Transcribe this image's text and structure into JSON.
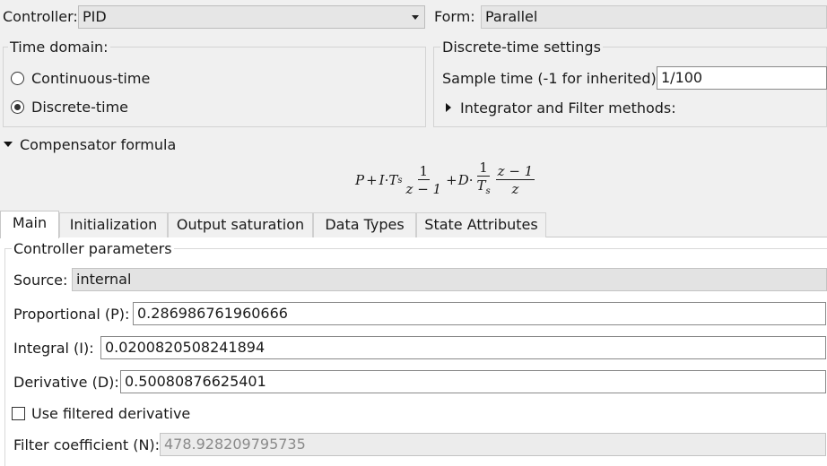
{
  "controller": {
    "label": "Controller:",
    "value": "PID"
  },
  "form": {
    "label": "Form:",
    "value": "Parallel"
  },
  "time_domain": {
    "title": "Time domain:",
    "options": [
      {
        "label": "Continuous-time",
        "selected": false
      },
      {
        "label": "Discrete-time",
        "selected": true
      }
    ]
  },
  "discrete_settings": {
    "title": "Discrete-time settings",
    "sample_time_label": "Sample time (-1 for inherited):",
    "sample_time_value": "1/100",
    "methods_label": "Integrator and Filter methods:"
  },
  "compensator": {
    "label": "Compensator formula",
    "formula": {
      "p": "P",
      "plus1": "+",
      "i": "I",
      "dot1": "·",
      "t": "T",
      "s": "s",
      "one": "1",
      "zm1": "z − 1",
      "plus2": "+",
      "d": "D",
      "dot2": "·",
      "one2": "1",
      "ts": "T",
      "s2": "s",
      "zm1b": "z − 1",
      "z": "z"
    }
  },
  "tabs": [
    {
      "label": "Main",
      "active": true
    },
    {
      "label": "Initialization",
      "active": false
    },
    {
      "label": "Output saturation",
      "active": false
    },
    {
      "label": "Data Types",
      "active": false
    },
    {
      "label": "State Attributes",
      "active": false
    }
  ],
  "params": {
    "title": "Controller parameters",
    "source_label": "Source:",
    "source_value": "internal",
    "p_label": "Proportional (P):",
    "p_value": "0.286986761960666",
    "i_label": "Integral (I):",
    "i_value": "0.0200820508241894",
    "d_label": "Derivative (D):",
    "d_value": "0.50080876625401",
    "filtered_label": "Use filtered derivative",
    "filtered_checked": false,
    "n_label": "Filter coefficient (N):",
    "n_value": "478.928209795735"
  }
}
